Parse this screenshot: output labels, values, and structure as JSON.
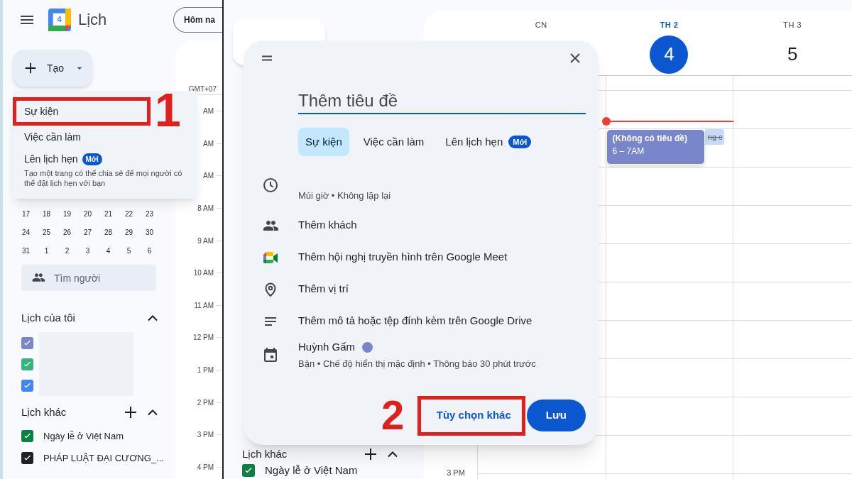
{
  "left_screen": {
    "app_title": "Lịch",
    "logo_day": "4",
    "today_button": "Hôm na",
    "create_button": "Tạo",
    "create_menu": [
      {
        "label": "Sự kiện"
      },
      {
        "label": "Việc cần làm"
      },
      {
        "label": "Lên lịch hẹn",
        "badge": "Mới",
        "description": "Tạo một trang có thể chia sẻ để mọi người có thể đặt lịch hẹn với bạn"
      }
    ],
    "mini_calendar_weeks": [
      [
        "17",
        "18",
        "19",
        "20",
        "21",
        "22",
        "23"
      ],
      [
        "24",
        "25",
        "26",
        "27",
        "28",
        "29",
        "30"
      ],
      [
        "31",
        "1",
        "2",
        "3",
        "4",
        "5",
        "6"
      ]
    ],
    "people_search": {
      "placeholder": "Tìm người"
    },
    "my_calendars": {
      "title": "Lịch của tôi",
      "expanded": true,
      "items": [
        {
          "color": "#7986cb",
          "checked": true
        },
        {
          "color": "#33b679",
          "checked": true
        },
        {
          "color": "#4285f4",
          "checked": true
        }
      ]
    },
    "other_calendars": {
      "title": "Lịch khác",
      "expanded": true,
      "items": [
        {
          "label": "Ngày lễ ở Việt Nam",
          "color": "#0b8043",
          "checked": true
        },
        {
          "label": "PHÁP LUẬT ĐẠI CƯƠNG_...",
          "color": "#202124",
          "checked": true
        }
      ]
    },
    "timezone": "GMT+07",
    "time_labels": [
      "AM",
      "AM",
      "AM",
      "8 AM",
      "9 AM",
      "10 AM",
      "11 AM",
      "12 PM",
      "1 PM",
      "2 PM",
      "3 PM",
      "4 PM"
    ]
  },
  "right_screen": {
    "other_calendars": {
      "title": "Lịch khác",
      "expanded": true,
      "items": [
        {
          "label": "Ngày lễ ở Việt Nam",
          "color": "#0b8043",
          "checked": true
        }
      ]
    },
    "days": [
      {
        "weekday": "CN",
        "selected": false
      },
      {
        "weekday": "TH 2",
        "date": "4",
        "selected": true
      },
      {
        "weekday": "TH 3",
        "date": "5",
        "selected": false
      }
    ],
    "time_labels": [
      "3 PM"
    ],
    "hidden_event": {
      "text": "ng c"
    },
    "event": {
      "title": "(Không có tiêu đề)",
      "time": "6 – 7AM"
    },
    "dialog": {
      "title_placeholder": "Thêm tiêu đề",
      "tabs": [
        {
          "label": "Sự kiện",
          "selected": true
        },
        {
          "label": "Việc cần làm",
          "selected": false
        },
        {
          "label": "Lên lịch hẹn",
          "badge": "Mới",
          "selected": false
        }
      ],
      "rows": [
        {
          "text": "Múi giờ • Không lặp lại"
        },
        {
          "text": "Thêm khách"
        },
        {
          "text": "Thêm hội nghị truyền hình trên Google Meet"
        },
        {
          "text": "Thêm vị trí"
        },
        {
          "text": "Thêm mô tả hoặc tệp đính kèm trên Google Drive"
        },
        {
          "text": "Huỳnh Gấm",
          "color": "#7986cb",
          "detail": "Bận • Chế độ hiển thị mặc định • Thông báo 30 phút trước"
        }
      ],
      "buttons": [
        {
          "label": "Tùy chọn khác",
          "kind": "text"
        },
        {
          "label": "Lưu",
          "kind": "filled"
        }
      ]
    }
  },
  "annotations": [
    {
      "number": "1"
    },
    {
      "number": "2"
    }
  ]
}
